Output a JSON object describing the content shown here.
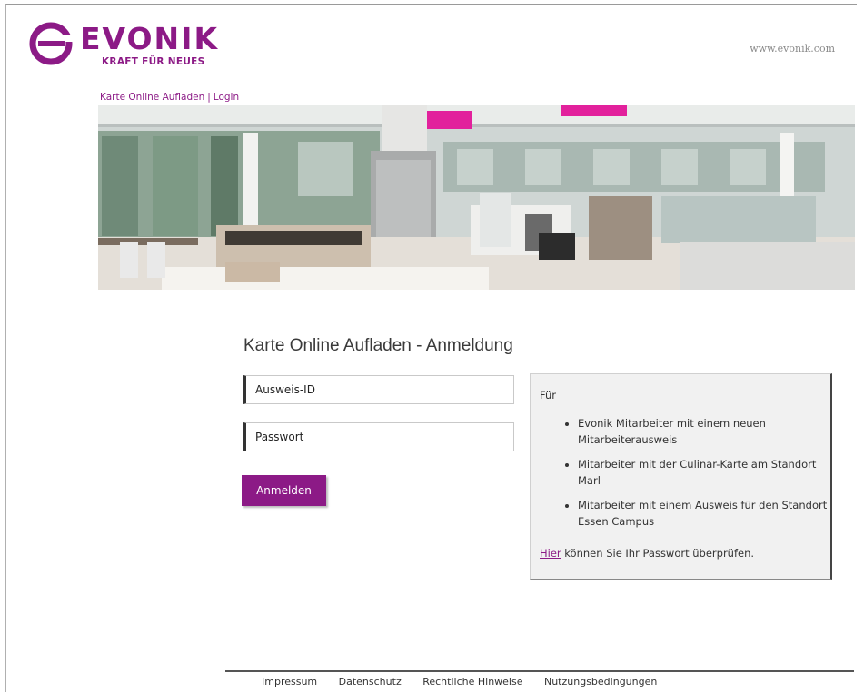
{
  "header": {
    "brand": "EVONIK",
    "tagline": "KRAFT FÜR NEUES",
    "site_link": "www.evonik.com",
    "brand_color": "#8c1a86"
  },
  "topnav": {
    "item1": "Karte Online Aufladen",
    "separator": "|",
    "item2": "Login"
  },
  "hero": {
    "icon": "canteen-photo"
  },
  "login": {
    "title": "Karte Online Aufladen - Anmeldung",
    "username_placeholder": "Ausweis-ID",
    "password_placeholder": "Passwort",
    "submit_label": "Anmelden"
  },
  "info": {
    "heading": "Für",
    "items": [
      "Evonik Mitarbeiter mit einem neuen Mitarbeiterausweis",
      "Mitarbeiter mit der Culinar-Karte am Standort Marl",
      "Mitarbeiter mit einem Ausweis für den Standort Essen Campus"
    ],
    "footer_highlight": "Hier",
    "footer_text": " können Sie Ihr Passwort überprüfen."
  },
  "footer": {
    "links": [
      "Impressum",
      "Datenschutz",
      "Rechtliche Hinweise",
      "Nutzungsbedingungen"
    ]
  }
}
